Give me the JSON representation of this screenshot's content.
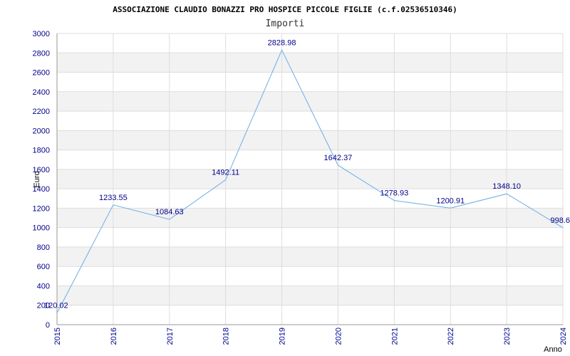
{
  "chart_data": {
    "type": "line",
    "title": "ASSOCIAZIONE CLAUDIO BONAZZI PRO HOSPICE PICCOLE FIGLIE (c.f.02536510346)",
    "subtitle": "Importi",
    "ylabel": "Euro",
    "xlabel": "Anno",
    "ylim": [
      0,
      3000
    ],
    "yticks": [
      0,
      200,
      400,
      600,
      800,
      1000,
      1200,
      1400,
      1600,
      1800,
      2000,
      2200,
      2400,
      2600,
      2800,
      3000
    ],
    "grid": true,
    "x": [
      "2015",
      "2016",
      "2017",
      "2018",
      "2019",
      "2020",
      "2021",
      "2022",
      "2023",
      "2024"
    ],
    "values": [
      120.02,
      1233.55,
      1084.63,
      1492.11,
      2828.98,
      1642.37,
      1278.93,
      1200.91,
      1348.1,
      998.6
    ],
    "labels": [
      "120.02",
      "1233.55",
      "1084.63",
      "1492.11",
      "2828.98",
      "1642.37",
      "1278.93",
      "1200.91",
      "1348.10",
      "998.6"
    ],
    "colors": {
      "line": "#6aaee8",
      "band": "#f2f2f2",
      "gridline": "#dddddd",
      "tick": "#00008b"
    }
  }
}
